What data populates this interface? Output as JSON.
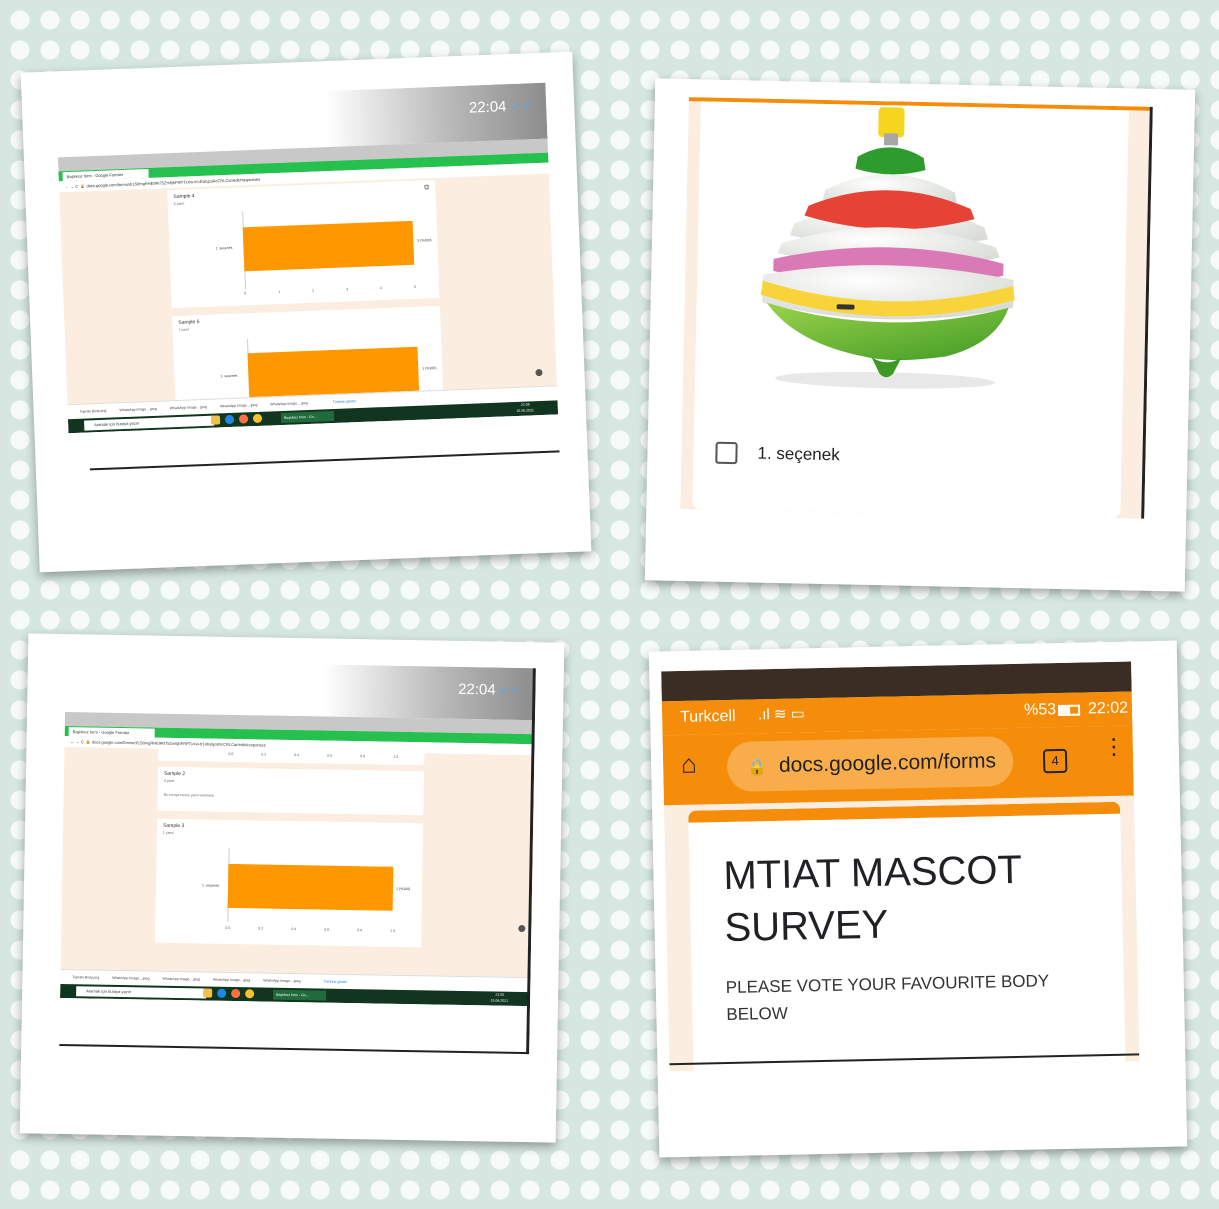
{
  "desktop_a": {
    "clock": "22:04",
    "tab_title": "Başlıksız form - Google Formlar",
    "url": "docs.google.com/forms/d/1S0mgRHE9RI75Zm5jhFRPTxXw-tr14hxbjcsRcCRLCar/edit#responses",
    "card1": {
      "title": "Sample 4",
      "subtitle": "5 yanıt",
      "bar_label": "1. seçenek",
      "value_label": "5 (%100)",
      "chart_data": {
        "type": "bar",
        "categories": [
          "1. seçenek"
        ],
        "values": [
          5
        ],
        "xlim": [
          0,
          5
        ],
        "ticks": [
          "0",
          "1",
          "2",
          "3",
          "4",
          "5"
        ]
      }
    },
    "card2": {
      "title": "Sample 5",
      "subtitle": "1 yanıt",
      "bar_label": "1. seçenek",
      "value_label": "1 (%100)",
      "chart_data": {
        "type": "bar",
        "categories": [
          "1. seçenek"
        ],
        "values": [
          1
        ]
      }
    },
    "downloads": [
      "Topraki Body.png",
      "WhatsApp Image....jpeg",
      "WhatsApp Image....jpeg",
      "WhatsApp Image....jpeg",
      "WhatsApp Image....jpeg"
    ],
    "show_all": "Tümünü göster",
    "taskbar_search": "Aramak için buraya yazın",
    "taskbar_app": "Başlıksız form - Go...",
    "taskbar_time": "21:56",
    "taskbar_date": "15.06.2021"
  },
  "phone_a": {
    "option_label": "1. seçenek",
    "colors": {
      "frame": "#fbeee0",
      "accent": "#f68d0a"
    }
  },
  "desktop_b": {
    "clock": "22:04",
    "tab_title": "Başlıksız form - Google Formlar",
    "url": "docs.google.com/forms/d/1S0mgRHE9RI75Zm5jhFRPTxXw-tr14hxbjcsRcCRLCar/edit#responses",
    "top_ticks": [
      "0.0",
      "0.2",
      "0.4",
      "0.6",
      "0.8",
      "1.0"
    ],
    "card1": {
      "title": "Sample 2",
      "subtitle": "0 yanıt",
      "note": "Bu soruya henüz yanıt verilmedi."
    },
    "card2": {
      "title": "Sample 3",
      "subtitle": "1 yanıt",
      "bar_label": "1. seçenek",
      "value_label": "1 (%100)",
      "chart_data": {
        "type": "bar",
        "categories": [
          "1. seçenek"
        ],
        "values": [
          1
        ],
        "xlim": [
          0,
          1
        ],
        "ticks": [
          "0.0",
          "0.2",
          "0.4",
          "0.6",
          "0.8",
          "1.0"
        ]
      }
    },
    "downloads": [
      "Topraki Body.png",
      "WhatsApp Image....jpeg",
      "WhatsApp Image....jpeg",
      "WhatsApp Image....jpeg",
      "WhatsApp Image....jpeg"
    ],
    "show_all": "Tümünü göster",
    "taskbar_search": "Aramak için buraya yazın",
    "taskbar_app": "Başlıksız form - Go...",
    "taskbar_time": "21:55",
    "taskbar_date": "15.06.2021"
  },
  "phone_b": {
    "carrier": "Turkcell",
    "battery": "%53",
    "time": "22:02",
    "url": "docs.google.com/forms",
    "tab_count": "4",
    "form_title": "MTIAT MASCOT SURVEY",
    "form_description": "PLEASE VOTE YOUR FAVOURITE BODY BELOW"
  }
}
